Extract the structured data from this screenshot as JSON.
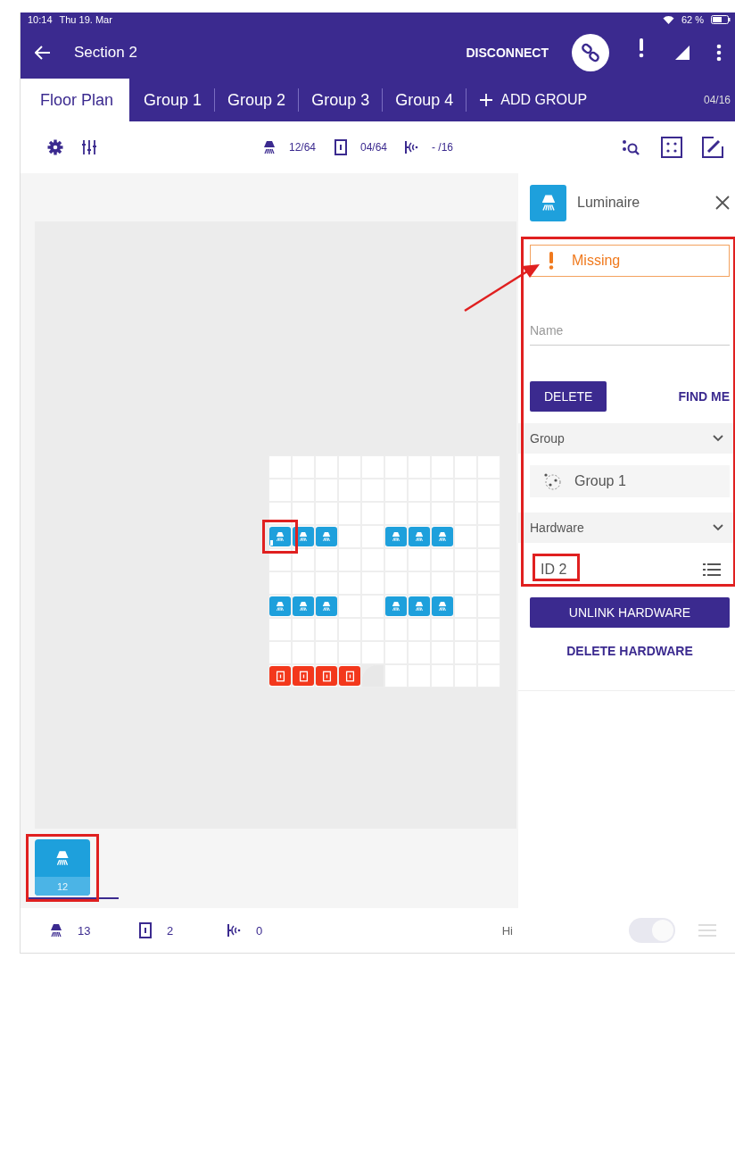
{
  "status_bar": {
    "time": "10:14",
    "date": "Thu 19. Mar",
    "battery": "62 %"
  },
  "header": {
    "title": "Section 2",
    "action": "DISCONNECT"
  },
  "tabs": [
    {
      "label": "Floor Plan",
      "selected": true
    },
    {
      "label": "Group 1",
      "selected": false
    },
    {
      "label": "Group 2",
      "selected": false
    },
    {
      "label": "Group 3",
      "selected": false
    },
    {
      "label": "Group 4",
      "selected": false
    }
  ],
  "add_group": "ADD GROUP",
  "group_count": "04/16",
  "toolbar": {
    "counters": [
      {
        "kind": "luminaire",
        "text": "12/64"
      },
      {
        "kind": "switch",
        "text": "04/64"
      },
      {
        "kind": "sensor",
        "text": "- /16"
      }
    ]
  },
  "floor_plan": {
    "grid": [
      [
        {
          "kind": "empty"
        },
        {
          "kind": "empty"
        },
        {
          "kind": "empty"
        },
        {
          "kind": "empty"
        },
        {
          "kind": "empty"
        },
        {
          "kind": "empty"
        },
        {
          "kind": "empty"
        },
        {
          "kind": "empty"
        },
        {
          "kind": "empty"
        },
        {
          "kind": "empty"
        }
      ],
      [
        {
          "kind": "empty"
        },
        {
          "kind": "empty"
        },
        {
          "kind": "empty"
        },
        {
          "kind": "empty"
        },
        {
          "kind": "empty"
        },
        {
          "kind": "empty"
        },
        {
          "kind": "empty"
        },
        {
          "kind": "empty"
        },
        {
          "kind": "empty"
        },
        {
          "kind": "empty"
        }
      ],
      [
        {
          "kind": "empty"
        },
        {
          "kind": "empty"
        },
        {
          "kind": "empty"
        },
        {
          "kind": "empty"
        },
        {
          "kind": "empty"
        },
        {
          "kind": "empty"
        },
        {
          "kind": "empty"
        },
        {
          "kind": "empty"
        },
        {
          "kind": "empty"
        },
        {
          "kind": "empty"
        }
      ],
      [
        {
          "kind": "luminaire",
          "missing": true
        },
        {
          "kind": "luminaire",
          "missing": false
        },
        {
          "kind": "luminaire",
          "missing": false
        },
        {
          "kind": "empty"
        },
        {
          "kind": "empty"
        },
        {
          "kind": "luminaire",
          "missing": false
        },
        {
          "kind": "luminaire",
          "missing": false
        },
        {
          "kind": "luminaire",
          "missing": false
        },
        {
          "kind": "empty"
        },
        {
          "kind": "empty"
        }
      ],
      [
        {
          "kind": "empty"
        },
        {
          "kind": "empty"
        },
        {
          "kind": "empty"
        },
        {
          "kind": "empty"
        },
        {
          "kind": "empty"
        },
        {
          "kind": "empty"
        },
        {
          "kind": "empty"
        },
        {
          "kind": "empty"
        },
        {
          "kind": "empty"
        },
        {
          "kind": "empty"
        }
      ],
      [
        {
          "kind": "empty"
        },
        {
          "kind": "empty"
        },
        {
          "kind": "empty"
        },
        {
          "kind": "empty"
        },
        {
          "kind": "empty"
        },
        {
          "kind": "empty"
        },
        {
          "kind": "empty"
        },
        {
          "kind": "empty"
        },
        {
          "kind": "empty"
        },
        {
          "kind": "empty"
        }
      ],
      [
        {
          "kind": "luminaire",
          "missing": false
        },
        {
          "kind": "luminaire",
          "missing": false
        },
        {
          "kind": "luminaire",
          "missing": false
        },
        {
          "kind": "empty"
        },
        {
          "kind": "empty"
        },
        {
          "kind": "luminaire",
          "missing": false
        },
        {
          "kind": "luminaire",
          "missing": false
        },
        {
          "kind": "luminaire",
          "missing": false
        },
        {
          "kind": "empty"
        },
        {
          "kind": "empty"
        }
      ],
      [
        {
          "kind": "empty"
        },
        {
          "kind": "empty"
        },
        {
          "kind": "empty"
        },
        {
          "kind": "empty"
        },
        {
          "kind": "empty"
        },
        {
          "kind": "empty"
        },
        {
          "kind": "empty"
        },
        {
          "kind": "empty"
        },
        {
          "kind": "empty"
        },
        {
          "kind": "empty"
        }
      ],
      [
        {
          "kind": "empty"
        },
        {
          "kind": "empty"
        },
        {
          "kind": "empty"
        },
        {
          "kind": "empty"
        },
        {
          "kind": "empty"
        },
        {
          "kind": "empty"
        },
        {
          "kind": "empty"
        },
        {
          "kind": "empty"
        },
        {
          "kind": "empty"
        },
        {
          "kind": "empty"
        }
      ],
      [
        {
          "kind": "switch"
        },
        {
          "kind": "switch"
        },
        {
          "kind": "switch"
        },
        {
          "kind": "switch"
        },
        {
          "kind": "void"
        },
        {
          "kind": "empty"
        },
        {
          "kind": "empty"
        },
        {
          "kind": "empty"
        },
        {
          "kind": "empty"
        },
        {
          "kind": "empty"
        }
      ]
    ]
  },
  "tray": [
    {
      "kind": "luminaire",
      "count": "12"
    }
  ],
  "panel": {
    "title": "Luminaire",
    "status": "Missing",
    "name_placeholder": "Name",
    "delete": "DELETE",
    "find": "FIND ME",
    "sections": [
      {
        "label": "Group",
        "expanded": true,
        "kind": "group",
        "value": "Group 1"
      },
      {
        "label": "Hardware",
        "expanded": true,
        "kind": "hardware",
        "value": "ID 2"
      }
    ],
    "unlink": "UNLINK HARDWARE",
    "delete_hardware": "DELETE HARDWARE"
  },
  "bottom_bar": {
    "counts": [
      {
        "kind": "luminaire",
        "text": "13"
      },
      {
        "kind": "switch",
        "text": "2"
      },
      {
        "kind": "sensor",
        "text": "0"
      }
    ],
    "hide_label": "Hi",
    "hide_toggle": {
      "on": true
    }
  }
}
